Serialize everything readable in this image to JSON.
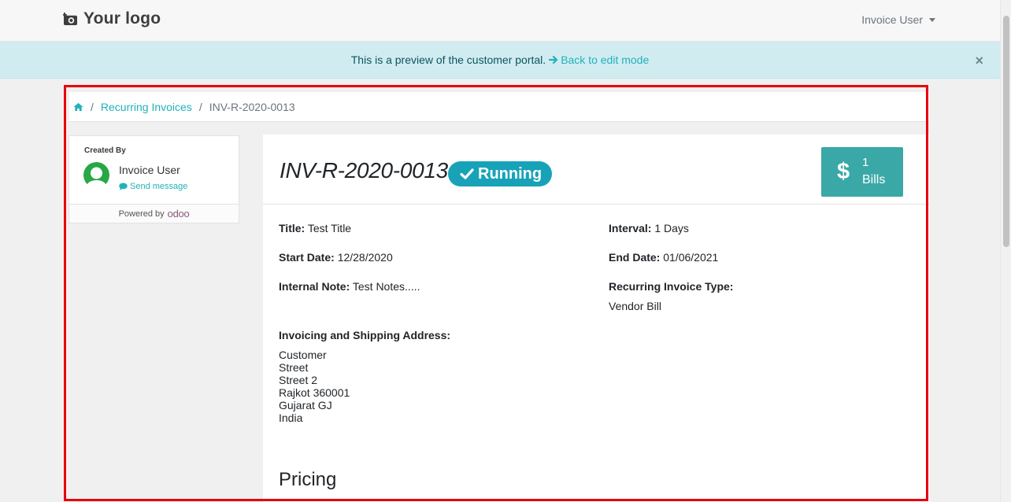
{
  "header": {
    "logo_text": "Your logo",
    "user_menu_label": "Invoice User"
  },
  "alert": {
    "message": "This is a preview of the customer portal.",
    "back_link": "Back to edit mode",
    "close_symbol": "×"
  },
  "breadcrumb": {
    "sep": "/",
    "items": [
      "Recurring Invoices",
      "INV-R-2020-0013"
    ]
  },
  "sidebar": {
    "created_by_label": "Created By",
    "user_name": "Invoice User",
    "send_message": "Send message",
    "powered_by": "Powered by",
    "powered_brand": "odoo"
  },
  "invoice": {
    "number": "INV-R-2020-0013",
    "status": "Running",
    "bills_count": "1",
    "bills_label": "Bills",
    "bills_symbol": "$",
    "fields": {
      "title_label": "Title:",
      "title_value": "Test Title",
      "interval_label": "Interval:",
      "interval_value": "1 Days",
      "start_label": "Start Date:",
      "start_value": "12/28/2020",
      "end_label": "End Date:",
      "end_value": "01/06/2021",
      "note_label": "Internal Note:",
      "note_value": "Test Notes.....",
      "type_label": "Recurring Invoice Type:",
      "type_value": "Vendor Bill",
      "address_label": "Invoicing and Shipping Address:"
    },
    "address_lines": [
      "Customer",
      "Street",
      "Street 2",
      "Rajkot 360001",
      "Gujarat GJ",
      "India"
    ],
    "pricing_heading": "Pricing"
  },
  "colors": {
    "accent": "#21b2b9",
    "badge": "#17a2b8",
    "bills_button": "#3aa8a6",
    "highlight": "#e8000b",
    "alert_bg": "#d1ecf1",
    "avatar": "#28a745"
  },
  "icons": {
    "logo": "camera-icon",
    "home": "home-icon",
    "back": "arrow-right-icon",
    "message": "comment-icon",
    "status": "check-icon",
    "bills": "dollar-icon"
  }
}
